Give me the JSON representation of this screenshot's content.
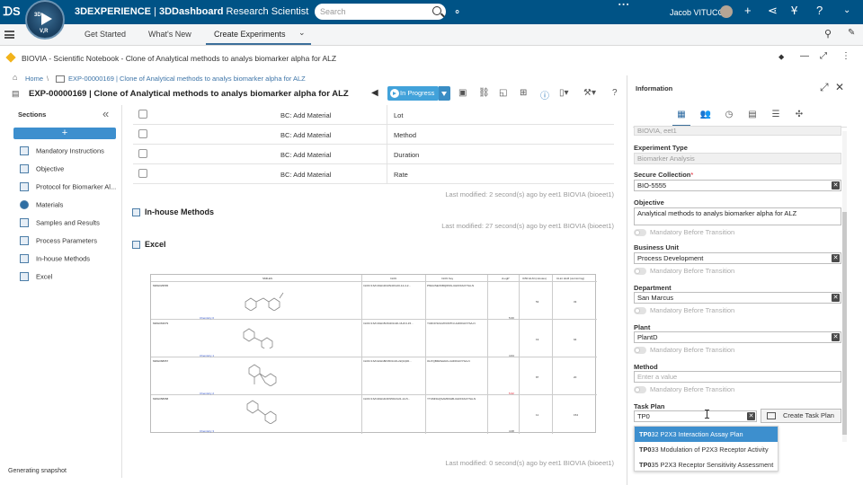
{
  "topbar": {
    "brand_main": "3DEXPERIENCE",
    "brand_sep": " | ",
    "brand_app": "3DDashboard",
    "brand_role": " Research Scientist",
    "search_placeholder": "Search",
    "user_name": "Jacob VITUCCI",
    "compass_q1": "3D",
    "compass_q2": "V,R"
  },
  "tabs": [
    {
      "label": "Get Started"
    },
    {
      "label": "What's New"
    },
    {
      "label": "Create Experiments"
    }
  ],
  "notebook": {
    "title": "BIOVIA - Scientific Notebook - Clone of Analytical methods to analys biomarker alpha for ALZ"
  },
  "breadcrumb": {
    "home": "Home",
    "sep": "\\",
    "exp": "EXP-00000169 | Clone of Analytical methods to analys biomarker alpha for ALZ"
  },
  "experiment": {
    "title": "EXP-00000169 | Clone of Analytical methods to analys biomarker alpha for ALZ",
    "status": "In Progress"
  },
  "sections": {
    "title": "Sections",
    "add_label": "+",
    "items": [
      {
        "label": "Mandatory Instructions"
      },
      {
        "label": "Objective"
      },
      {
        "label": "Protocol for Biomarker Al..."
      },
      {
        "label": "Materials"
      },
      {
        "label": "Samples and Results"
      },
      {
        "label": "Process Parameters"
      },
      {
        "label": "In-house Methods"
      },
      {
        "label": "Excel"
      }
    ]
  },
  "table_rows": [
    {
      "c1": "BC: Add Material",
      "c2": "Lot"
    },
    {
      "c1": "BC: Add Material",
      "c2": "Method"
    },
    {
      "c1": "BC: Add Material",
      "c2": "Duration"
    },
    {
      "c1": "BC: Add Material",
      "c2": "Rate"
    }
  ],
  "last_modified": [
    "Last modified: 2 second(s) ago by eet1 BIOVIA (bioeet1)",
    "Last modified: 27 second(s) ago by eet1 BIOVIA (bioeet1)",
    "Last modified: 0 second(s) ago by eet1 BIOVIA (bioeet1)"
  ],
  "section_heads": {
    "inhouse": "In-house Methods",
    "excel": "Excel"
  },
  "sheet": {
    "headers": [
      "SMILES",
      "InChI",
      "InChI Key",
      "cLogP",
      "IC50 HLM (minutes)",
      "CLint HLM (uL/min/mg)"
    ],
    "rows": [
      {
        "id": "MMH029565",
        "chem": "Chemistry 0",
        "inchi": "InChI=1S/C19H13Cl2N4O/c20-14-4-2...",
        "key": "PMHUSEXKBQWSS-UHFFFAOYSA-N",
        "clogp": "5.00",
        "ic50": "53",
        "clint": "33",
        "red": false
      },
      {
        "id": "MMH063979",
        "chem": "Chemistry 1",
        "inchi": "InChI=1S/C19H15ClN4O/c20-16-8-6-15...",
        "key": "YURCFSOLMXCMTN-UHFFFAOYSA-N",
        "clogp": "4.64",
        "ic50": "19",
        "clint": "94",
        "red": false
      },
      {
        "id": "MMH068957",
        "chem": "Chemistry 2",
        "inchi": "InChI=1S/C22H18FN5O/c23-22(24)30...",
        "key": "OHYQBRZGHRA-UHFFFAOYSA-N",
        "clogp": "5.02",
        "ic50": "87",
        "clint": "20",
        "red": true
      },
      {
        "id": "MMH058958",
        "chem": "Chemistry 3",
        "inchi": "InChI=1S/C20H14ClFN5O2/c21-14-5...",
        "key": "YTUMNGQSAMFDHB-UHFFFAOYSA-N",
        "clogp": "4.08",
        "ic50": "11",
        "clint": "154",
        "red": false
      }
    ]
  },
  "status_text": "Generating snapshot",
  "info": {
    "title": "Information",
    "top_value": "BIOVIA, eet1",
    "fields": {
      "experiment_type_label": "Experiment Type",
      "experiment_type_value": "Biomarker Analysis",
      "secure_collection_label": "Secure Collection",
      "secure_collection_req": "*",
      "secure_collection_value": "BIO-5555",
      "objective_label": "Objective",
      "objective_value": "Analytical methods to analys biomarker alpha for ALZ",
      "business_unit_label": "Business Unit",
      "business_unit_value": "Process Development",
      "department_label": "Department",
      "department_value": "San Marcus",
      "plant_label": "Plant",
      "plant_value": "PlantD",
      "method_label": "Method",
      "method_placeholder": "Enter a value",
      "task_plan_label": "Task Plan",
      "task_plan_value": "TP0"
    },
    "mandatory_text": "Mandatory Before Transition",
    "create_task_plan": "Create Task Plan",
    "suggestions": [
      {
        "match": "TP0",
        "rest": "32 P2X3 Interaction Assay Plan"
      },
      {
        "match": "TP0",
        "rest": "33 Modulation of P2X3 Receptor Activity"
      },
      {
        "match": "TP0",
        "rest": "35 P2X3 Receptor Sensitivity Assessment"
      }
    ]
  },
  "colors": {
    "topbar": "#005386",
    "accent": "#3d8fce",
    "status": "#42a2da"
  }
}
